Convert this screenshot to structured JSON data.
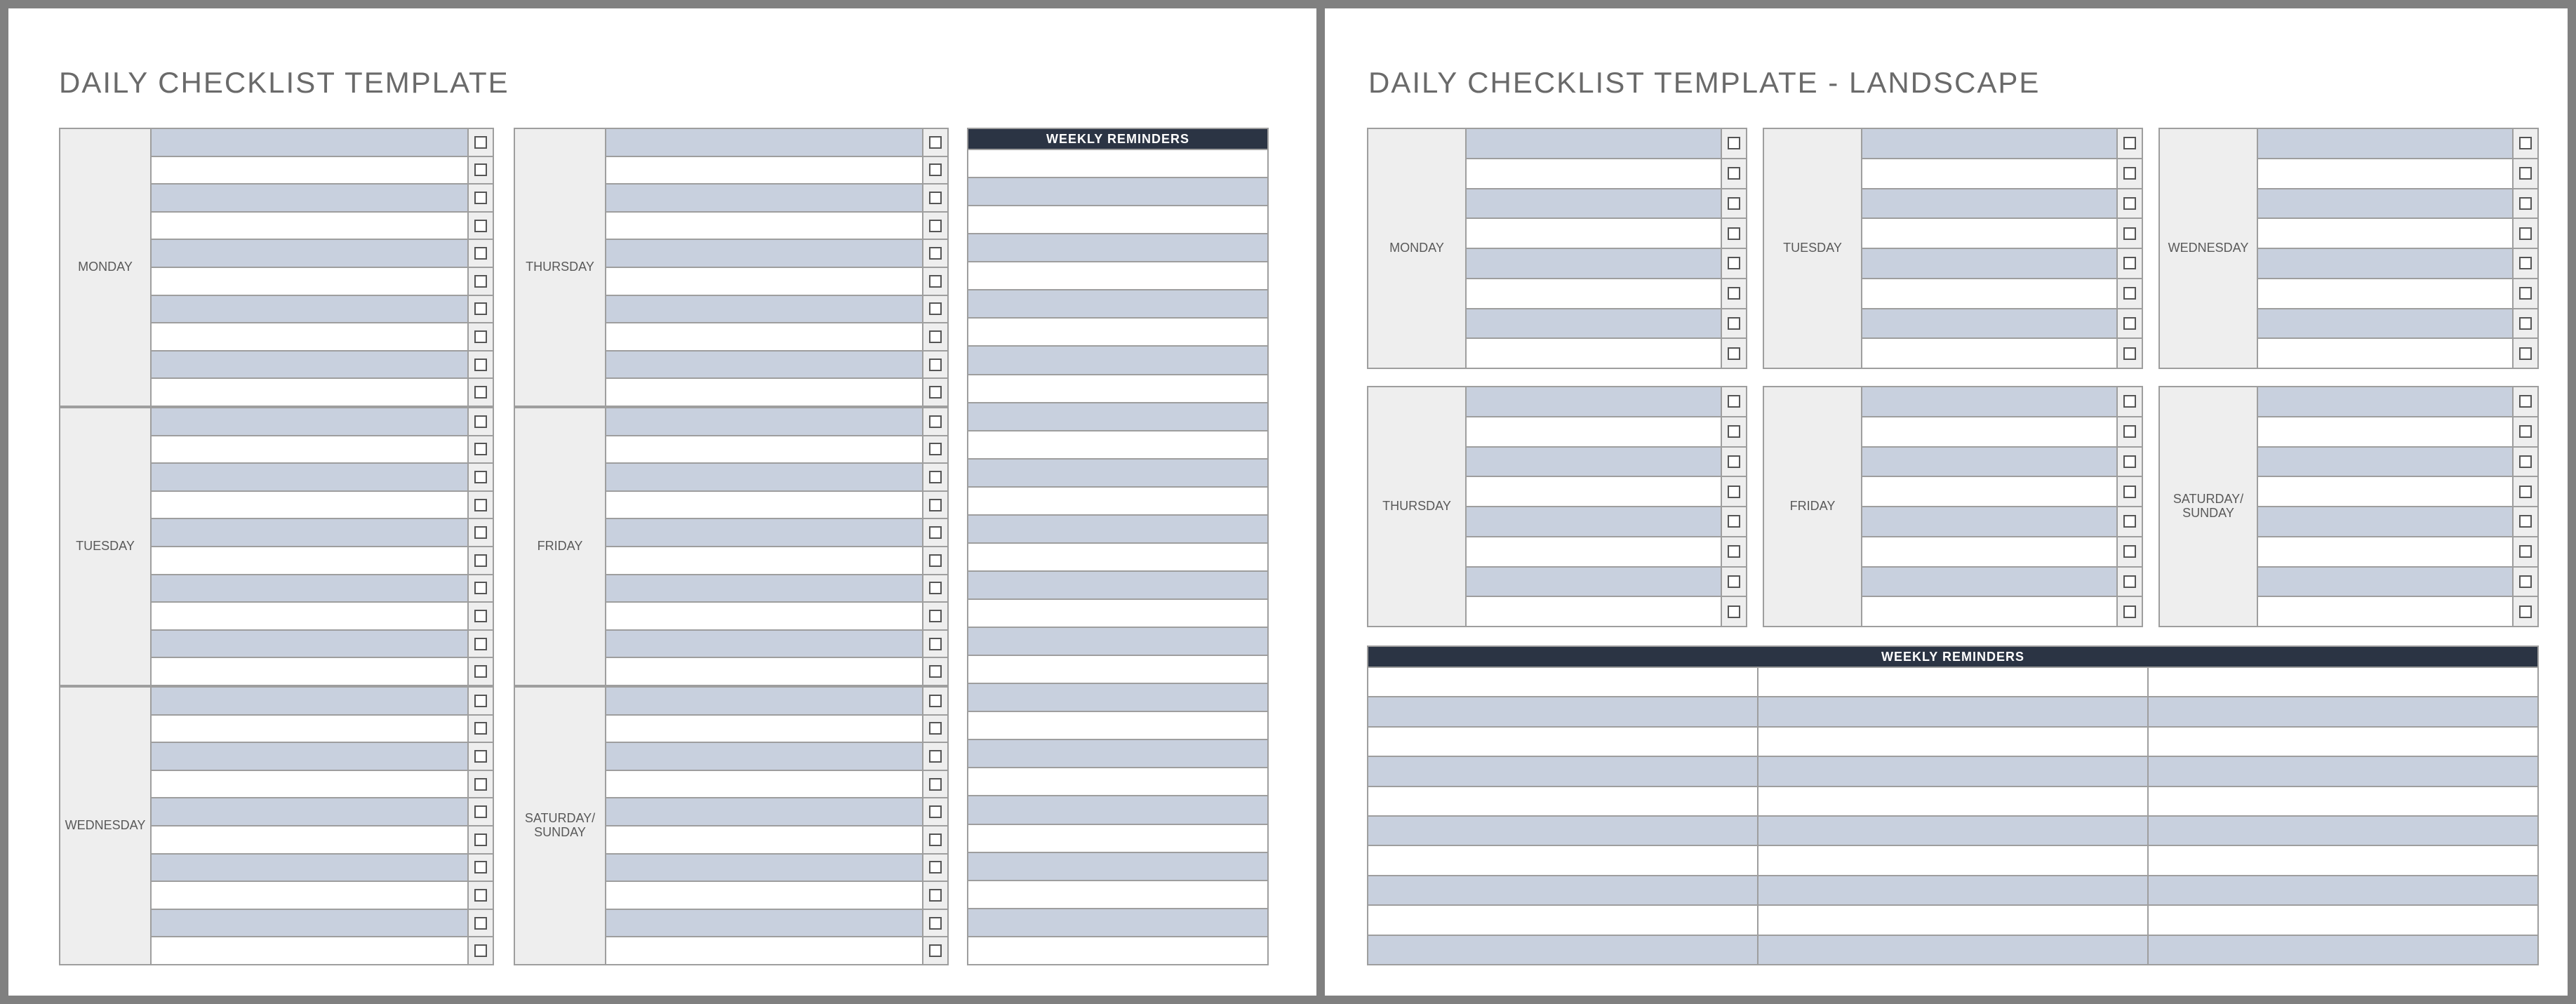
{
  "portrait": {
    "title": "DAILY CHECKLIST TEMPLATE",
    "weekly_header": "WEEKLY REMINDERS",
    "days": {
      "mon": "MONDAY",
      "tue": "TUESDAY",
      "wed": "WEDNESDAY",
      "thu": "THURSDAY",
      "fri": "FRIDAY",
      "satsun": "SATURDAY/\nSUNDAY"
    }
  },
  "landscape": {
    "title": "DAILY CHECKLIST TEMPLATE - LANDSCAPE",
    "weekly_header": "WEEKLY REMINDERS",
    "days": {
      "mon": "MONDAY",
      "tue": "TUESDAY",
      "wed": "WEDNESDAY",
      "thu": "THURSDAY",
      "fri": "FRIDAY",
      "satsun": "SATURDAY/\nSUNDAY"
    }
  }
}
